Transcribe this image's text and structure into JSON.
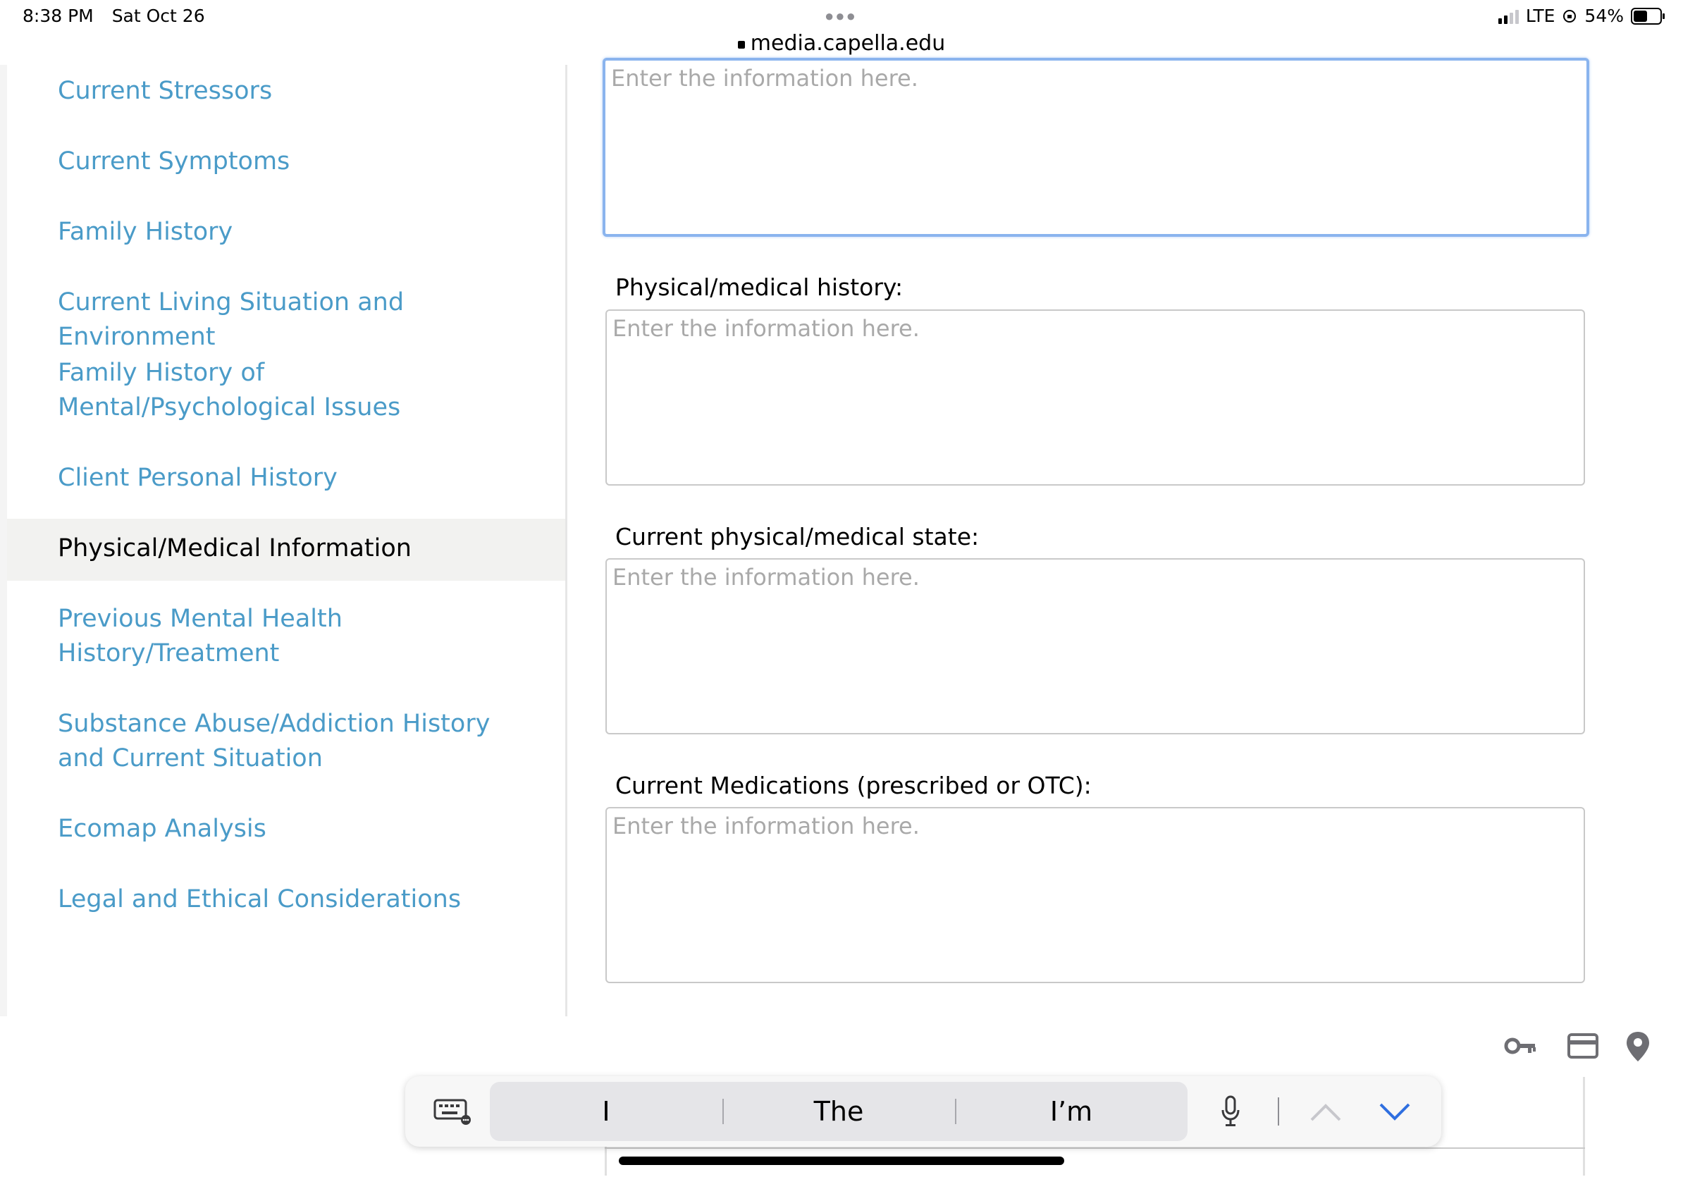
{
  "status_bar": {
    "time": "8:38 PM",
    "date": "Sat Oct 26",
    "url": "media.capella.edu",
    "network": "LTE",
    "battery": "54%",
    "battery_level": 0.54
  },
  "sidebar": {
    "items": [
      {
        "label": "Current Stressors"
      },
      {
        "label": "Current Symptoms"
      },
      {
        "label": "Family History"
      },
      {
        "label": "Current Living Situation and Environment"
      },
      {
        "label": "Family History of Mental/Psychological Issues"
      },
      {
        "label": "Client Personal History"
      },
      {
        "label": "Physical/Medical Information",
        "active": true
      },
      {
        "label": "Previous Mental Health History/Treatment"
      },
      {
        "label": "Substance Abuse/Addiction History and Current Situation"
      },
      {
        "label": "Ecomap Analysis"
      },
      {
        "label": "Legal and Ethical Considerations"
      }
    ]
  },
  "form": {
    "top_field": {
      "placeholder": "Enter the information here."
    },
    "fields": [
      {
        "label": "Physical/medical history:",
        "placeholder": "Enter the information here."
      },
      {
        "label": "Current physical/medical state:",
        "placeholder": "Enter the information here."
      },
      {
        "label": "Current Medications (prescribed or OTC):",
        "placeholder": "Enter the information here."
      }
    ]
  },
  "keyboard": {
    "suggestions": [
      "I",
      "The",
      "I’m"
    ],
    "icons": [
      "keyboard-icon",
      "microphone-icon",
      "chevron-up-icon",
      "chevron-down-icon",
      "key-icon",
      "credit-card-icon",
      "location-pin-icon"
    ]
  }
}
